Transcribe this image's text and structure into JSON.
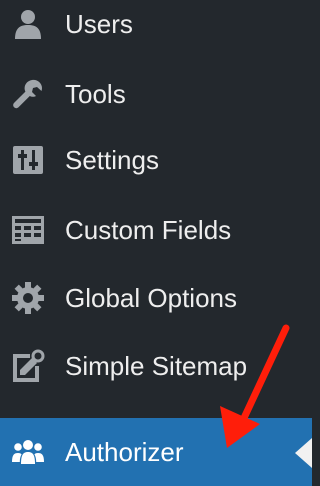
{
  "menu": {
    "items": [
      {
        "label": "Users",
        "icon": "users-icon"
      },
      {
        "label": "Tools",
        "icon": "wrench-icon"
      },
      {
        "label": "Settings",
        "icon": "sliders-icon"
      },
      {
        "label": "Custom Fields",
        "icon": "table-icon"
      },
      {
        "label": "Global Options",
        "icon": "gear-icon"
      },
      {
        "label": "Simple Sitemap",
        "icon": "sitemap-icon"
      },
      {
        "label": "Authorizer",
        "icon": "group-icon",
        "current": true
      }
    ]
  },
  "colors": {
    "sidebar_bg": "#23282d",
    "text": "#eeeeee",
    "icon": "#a0a5aa",
    "active_bg": "#2271b1",
    "annotation_arrow": "#ff1e0a"
  }
}
